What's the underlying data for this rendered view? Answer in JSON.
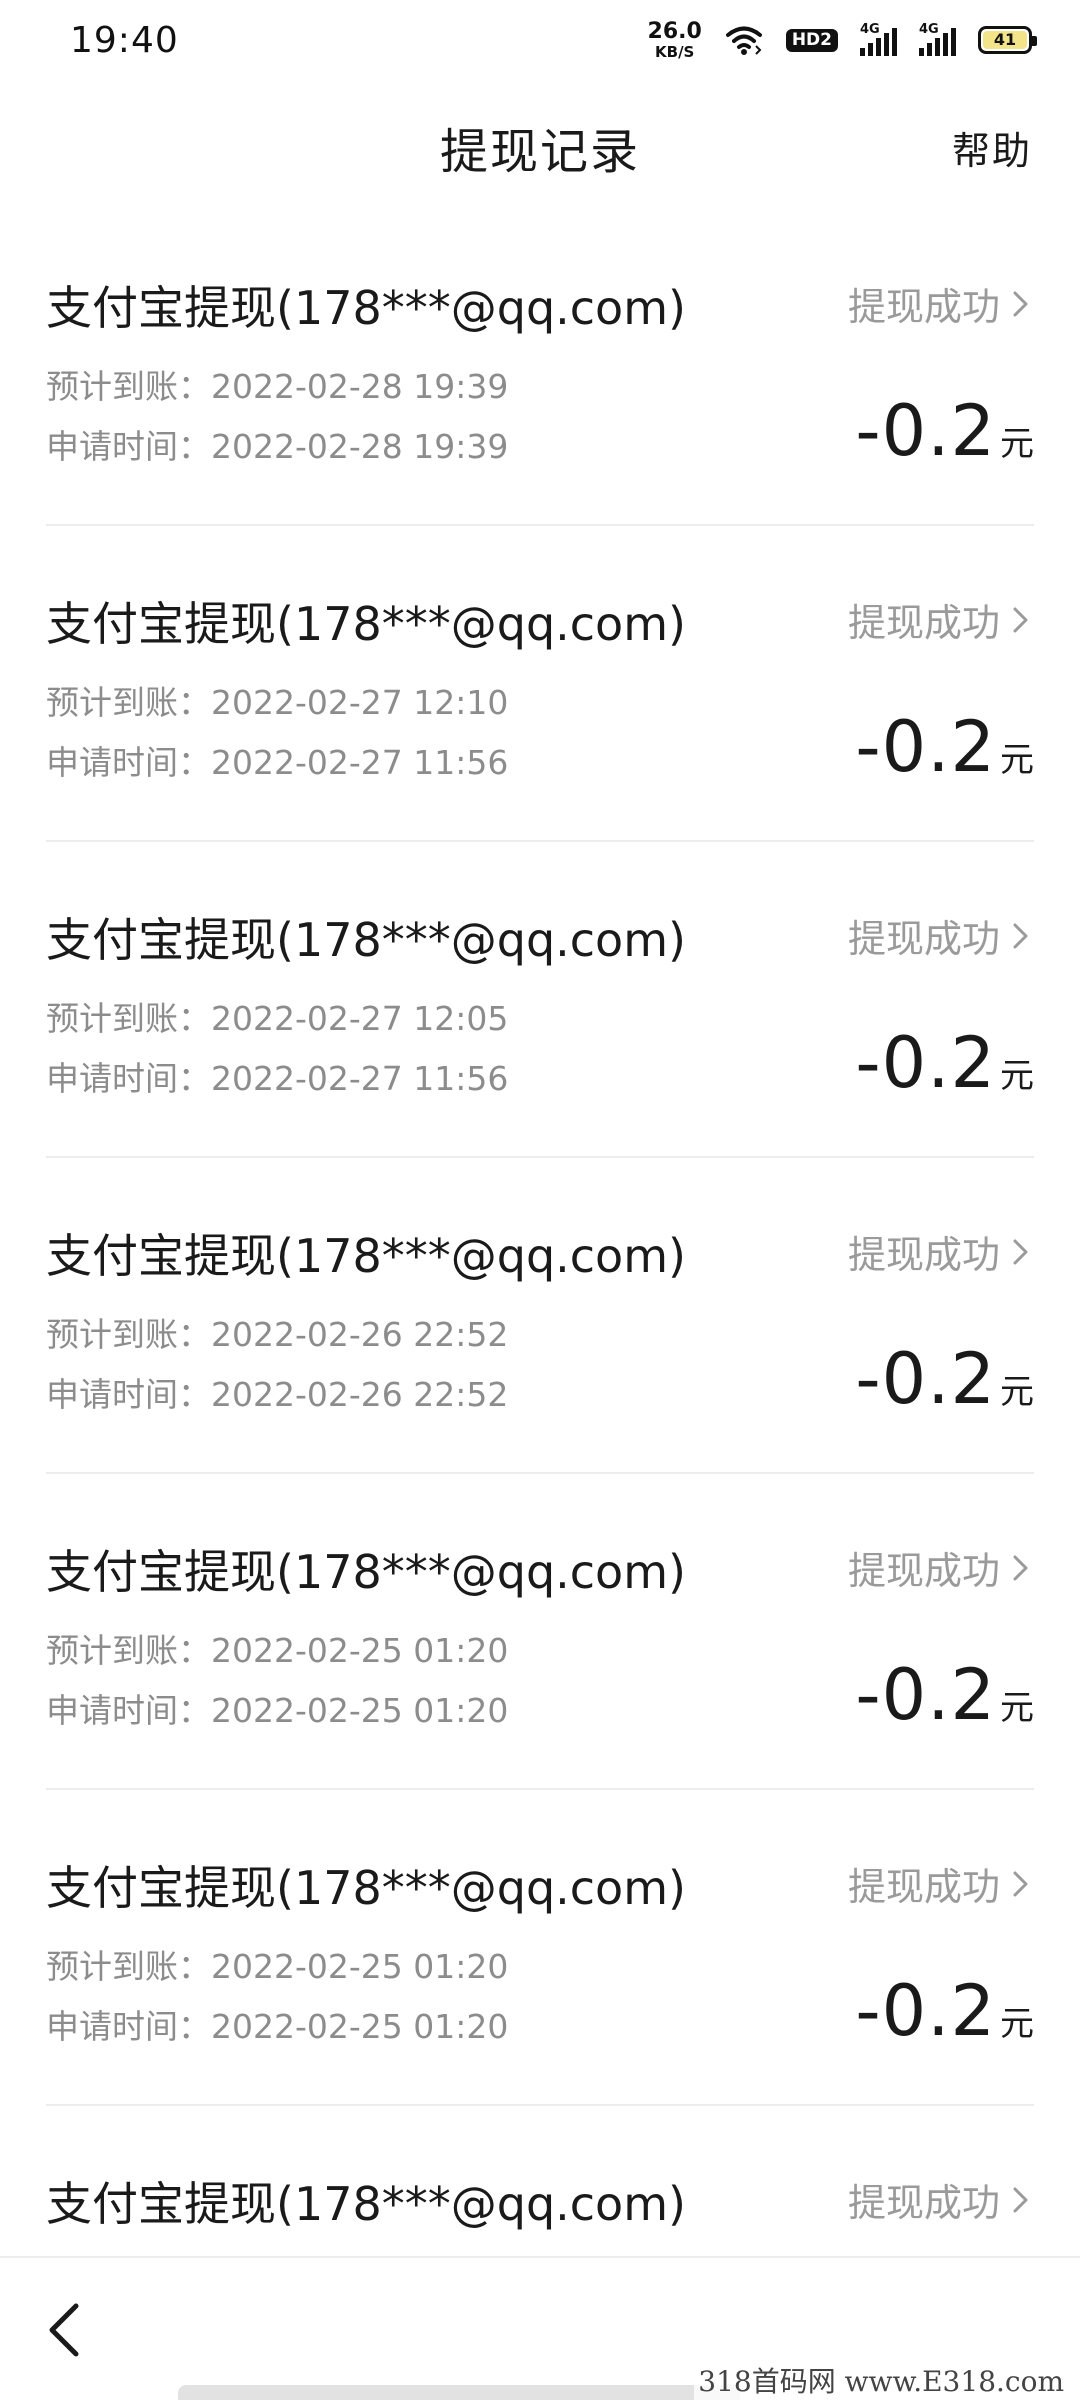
{
  "status_bar": {
    "time": "19:40",
    "net_speed_value": "26.0",
    "net_speed_unit": "KB/S",
    "hd_label": "HD2",
    "signal1_label": "4G",
    "signal2_label": "4G",
    "battery_level": "41",
    "icons": [
      "wifi-icon",
      "hd-icon",
      "signal-icon",
      "signal-icon",
      "battery-icon"
    ]
  },
  "header": {
    "title": "提现记录",
    "help": "帮助"
  },
  "records": [
    {
      "title": "支付宝提现(178***@qq.com)",
      "status": "提现成功",
      "expected_label": "预计到账：2022-02-28 19:39",
      "applied_label": "申请时间：2022-02-28 19:39",
      "amount": "-0.2",
      "unit": "元"
    },
    {
      "title": "支付宝提现(178***@qq.com)",
      "status": "提现成功",
      "expected_label": "预计到账：2022-02-27 12:10",
      "applied_label": "申请时间：2022-02-27 11:56",
      "amount": "-0.2",
      "unit": "元"
    },
    {
      "title": "支付宝提现(178***@qq.com)",
      "status": "提现成功",
      "expected_label": "预计到账：2022-02-27 12:05",
      "applied_label": "申请时间：2022-02-27 11:56",
      "amount": "-0.2",
      "unit": "元"
    },
    {
      "title": "支付宝提现(178***@qq.com)",
      "status": "提现成功",
      "expected_label": "预计到账：2022-02-26 22:52",
      "applied_label": "申请时间：2022-02-26 22:52",
      "amount": "-0.2",
      "unit": "元"
    },
    {
      "title": "支付宝提现(178***@qq.com)",
      "status": "提现成功",
      "expected_label": "预计到账：2022-02-25 01:20",
      "applied_label": "申请时间：2022-02-25 01:20",
      "amount": "-0.2",
      "unit": "元"
    },
    {
      "title": "支付宝提现(178***@qq.com)",
      "status": "提现成功",
      "expected_label": "预计到账：2022-02-25 01:20",
      "applied_label": "申请时间：2022-02-25 01:20",
      "amount": "-0.2",
      "unit": "元"
    },
    {
      "title": "支付宝提现(178***@qq.com)",
      "status": "提现成功"
    }
  ],
  "bottom_nav": {
    "back_icon": "chevron-left-icon"
  },
  "watermark": "318首码网 www.E318.com",
  "colors": {
    "text_primary": "#1a1a1a",
    "text_secondary": "#8c8c8c",
    "status_text": "#9a9a9a",
    "divider": "#ececec",
    "battery_fill": "#f3e48a"
  }
}
